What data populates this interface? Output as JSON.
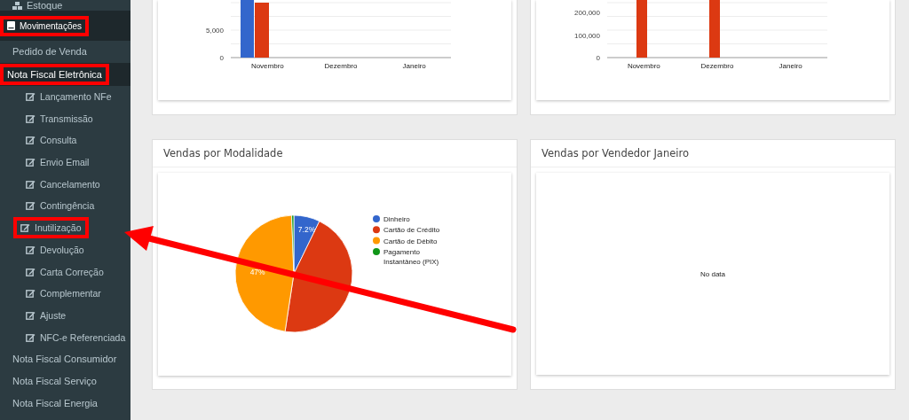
{
  "sidebar": {
    "items": [
      {
        "label": "Estoque",
        "kind": "section",
        "highlighted": false,
        "selected": false
      },
      {
        "label": "Movimentações",
        "kind": "header",
        "highlighted": true,
        "selected": true
      },
      {
        "label": "Pedido de Venda",
        "kind": "item",
        "highlighted": false,
        "selected": false
      },
      {
        "label": "Nota Fiscal Eletrônica",
        "kind": "item",
        "highlighted": true,
        "selected": true,
        "children": [
          {
            "label": "Lançamento NFe",
            "highlighted": false
          },
          {
            "label": "Transmissão",
            "highlighted": false
          },
          {
            "label": "Consulta",
            "highlighted": false
          },
          {
            "label": "Envio Email",
            "highlighted": false
          },
          {
            "label": "Cancelamento",
            "highlighted": false
          },
          {
            "label": "Contingência",
            "highlighted": false
          },
          {
            "label": "Inutilização",
            "highlighted": true
          },
          {
            "label": "Devolução",
            "highlighted": false
          },
          {
            "label": "Carta Correção",
            "highlighted": false
          },
          {
            "label": "Complementar",
            "highlighted": false
          },
          {
            "label": "Ajuste",
            "highlighted": false
          },
          {
            "label": "NFC-e Referenciada",
            "highlighted": false
          }
        ]
      },
      {
        "label": "Nota Fiscal Consumidor",
        "kind": "item",
        "highlighted": false,
        "selected": false
      },
      {
        "label": "Nota Fiscal Serviço",
        "kind": "item",
        "highlighted": false,
        "selected": false
      },
      {
        "label": "Nota Fiscal Energia",
        "kind": "item",
        "highlighted": false,
        "selected": false
      }
    ]
  },
  "top_charts": [
    {
      "y_labels": [
        "5,000",
        "0"
      ],
      "categories": [
        "Novembro",
        "Dezembro",
        "Janeiro"
      ]
    },
    {
      "y_labels": [
        "200,000",
        "100,000",
        "0"
      ],
      "categories": [
        "Novembro",
        "Dezembro",
        "Janeiro"
      ]
    }
  ],
  "cards": [
    {
      "title": "Vendas por Modalidade",
      "kind": "pie",
      "chart_data": {
        "type": "pie",
        "categories": [
          "Dinheiro",
          "Cartão de Crédito",
          "Cartão de Débito",
          "Pagamento Instantâneo (PIX)"
        ],
        "values": [
          7.2,
          45.2,
          47,
          0.6
        ],
        "legend": "right",
        "colors": [
          "#3366cc",
          "#dc3912",
          "#ff9900",
          "#109618"
        ],
        "value_labels": [
          "7.2%",
          null,
          "47%",
          null
        ]
      }
    },
    {
      "title": "Vendas por Vendedor Janeiro",
      "kind": "empty",
      "message": "No data"
    }
  ]
}
